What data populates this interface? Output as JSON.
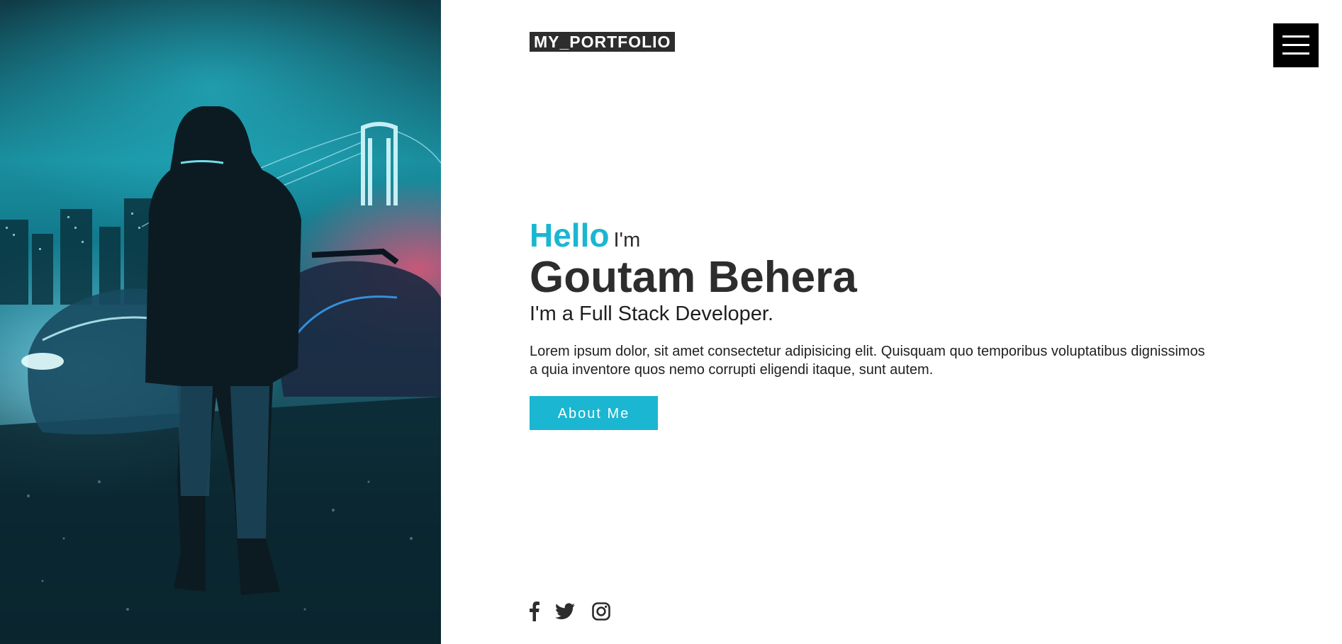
{
  "header": {
    "logo_text": "MY_PORTFOLIO"
  },
  "intro": {
    "hello": "Hello",
    "im": "I'm",
    "name": "Goutam Behera",
    "role": "I'm a Full Stack Developer.",
    "description": "Lorem ipsum dolor, sit amet consectetur adipisicing elit. Quisquam quo temporibus voluptatibus dignissimos a quia inventore quos nemo corrupti eligendi itaque, sunt autem.",
    "cta_label": "About Me"
  },
  "socials": {
    "icons": [
      "facebook-icon",
      "twitter-icon",
      "instagram-icon"
    ]
  },
  "menu": {
    "icon": "hamburger-menu-icon"
  },
  "colors": {
    "accent": "#1bb6d1",
    "text_dark": "#2d2d2d",
    "logo_bg": "#2d2d2d",
    "menu_bg": "#000000"
  }
}
